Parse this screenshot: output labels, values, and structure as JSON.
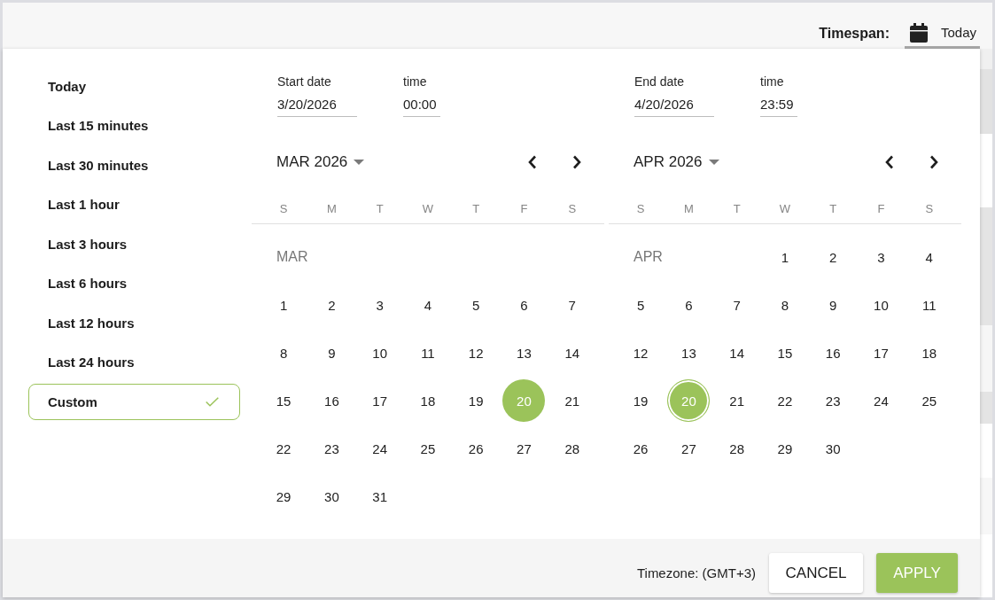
{
  "header": {
    "label": "Timespan:",
    "button": {
      "label": "Today"
    }
  },
  "presets": [
    {
      "label": "Today",
      "selected": false
    },
    {
      "label": "Last 15 minutes",
      "selected": false
    },
    {
      "label": "Last 30 minutes",
      "selected": false
    },
    {
      "label": "Last 1 hour",
      "selected": false
    },
    {
      "label": "Last 3 hours",
      "selected": false
    },
    {
      "label": "Last 6 hours",
      "selected": false
    },
    {
      "label": "Last 12 hours",
      "selected": false
    },
    {
      "label": "Last 24 hours",
      "selected": false
    },
    {
      "label": "Custom",
      "selected": true
    }
  ],
  "calendars": [
    {
      "date_label": "Start date",
      "date": "3/20/2026",
      "time_label": "time",
      "time": "00:00",
      "title": "MAR 2026",
      "month_label": "MAR",
      "weekdays": [
        "S",
        "M",
        "T",
        "W",
        "T",
        "F",
        "S"
      ],
      "weeks": [
        [
          {
            "label": "1",
            "selected": false,
            "today": false
          },
          {
            "label": "2",
            "selected": false,
            "today": false
          },
          {
            "label": "3",
            "selected": false,
            "today": false
          },
          {
            "label": "4",
            "selected": false,
            "today": false
          },
          {
            "label": "5",
            "selected": false,
            "today": false
          },
          {
            "label": "6",
            "selected": false,
            "today": false
          },
          {
            "label": "7",
            "selected": false,
            "today": false
          }
        ],
        [
          {
            "label": "8",
            "selected": false,
            "today": false
          },
          {
            "label": "9",
            "selected": false,
            "today": false
          },
          {
            "label": "10",
            "selected": false,
            "today": false
          },
          {
            "label": "11",
            "selected": false,
            "today": false
          },
          {
            "label": "12",
            "selected": false,
            "today": false
          },
          {
            "label": "13",
            "selected": false,
            "today": false
          },
          {
            "label": "14",
            "selected": false,
            "today": false
          }
        ],
        [
          {
            "label": "15",
            "selected": false,
            "today": false
          },
          {
            "label": "16",
            "selected": false,
            "today": false
          },
          {
            "label": "17",
            "selected": false,
            "today": false
          },
          {
            "label": "18",
            "selected": false,
            "today": false
          },
          {
            "label": "19",
            "selected": false,
            "today": false
          },
          {
            "label": "20",
            "selected": true,
            "today": false
          },
          {
            "label": "21",
            "selected": false,
            "today": false
          }
        ],
        [
          {
            "label": "22",
            "selected": false,
            "today": false
          },
          {
            "label": "23",
            "selected": false,
            "today": false
          },
          {
            "label": "24",
            "selected": false,
            "today": false
          },
          {
            "label": "25",
            "selected": false,
            "today": false
          },
          {
            "label": "26",
            "selected": false,
            "today": false
          },
          {
            "label": "27",
            "selected": false,
            "today": false
          },
          {
            "label": "28",
            "selected": false,
            "today": false
          }
        ],
        [
          {
            "label": "29",
            "selected": false,
            "today": false
          },
          {
            "label": "30",
            "selected": false,
            "today": false
          },
          {
            "label": "31",
            "selected": false,
            "today": false
          }
        ]
      ]
    },
    {
      "date_label": "End date",
      "date": "4/20/2026",
      "time_label": "time",
      "time": "23:59",
      "title": "APR 2026",
      "month_label": "APR",
      "weekdays": [
        "S",
        "M",
        "T",
        "W",
        "T",
        "F",
        "S"
      ],
      "weeks": [
        [
          {
            "label": "1",
            "selected": false,
            "today": false
          },
          {
            "label": "2",
            "selected": false,
            "today": false
          },
          {
            "label": "3",
            "selected": false,
            "today": false
          },
          {
            "label": "4",
            "selected": false,
            "today": false
          }
        ],
        [
          {
            "label": "5",
            "selected": false,
            "today": false
          },
          {
            "label": "6",
            "selected": false,
            "today": false
          },
          {
            "label": "7",
            "selected": false,
            "today": false
          },
          {
            "label": "8",
            "selected": false,
            "today": false
          },
          {
            "label": "9",
            "selected": false,
            "today": false
          },
          {
            "label": "10",
            "selected": false,
            "today": false
          },
          {
            "label": "11",
            "selected": false,
            "today": false
          }
        ],
        [
          {
            "label": "12",
            "selected": false,
            "today": false
          },
          {
            "label": "13",
            "selected": false,
            "today": false
          },
          {
            "label": "14",
            "selected": false,
            "today": false
          },
          {
            "label": "15",
            "selected": false,
            "today": false
          },
          {
            "label": "16",
            "selected": false,
            "today": false
          },
          {
            "label": "17",
            "selected": false,
            "today": false
          },
          {
            "label": "18",
            "selected": false,
            "today": false
          }
        ],
        [
          {
            "label": "19",
            "selected": false,
            "today": false
          },
          {
            "label": "20",
            "selected": true,
            "today": true
          },
          {
            "label": "21",
            "selected": false,
            "today": false
          },
          {
            "label": "22",
            "selected": false,
            "today": false
          },
          {
            "label": "23",
            "selected": false,
            "today": false
          },
          {
            "label": "24",
            "selected": false,
            "today": false
          },
          {
            "label": "25",
            "selected": false,
            "today": false
          }
        ],
        [
          {
            "label": "26",
            "selected": false,
            "today": false
          },
          {
            "label": "27",
            "selected": false,
            "today": false
          },
          {
            "label": "28",
            "selected": false,
            "today": false
          },
          {
            "label": "29",
            "selected": false,
            "today": false
          },
          {
            "label": "30",
            "selected": false,
            "today": false
          }
        ]
      ]
    }
  ],
  "footer": {
    "timezone": "Timezone: (GMT+3)",
    "buttons": [
      {
        "label": "CANCEL",
        "kind": "cancel"
      },
      {
        "label": "APPLY",
        "kind": "apply"
      }
    ]
  }
}
